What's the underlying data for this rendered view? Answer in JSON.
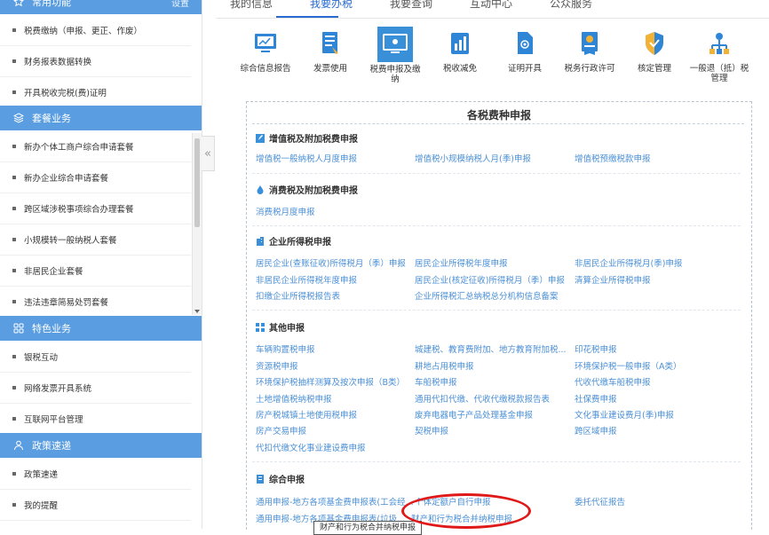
{
  "sidebar": {
    "sections": [
      {
        "title": "常用功能",
        "extra": "设置",
        "icon": "star-icon"
      },
      {
        "title": "套餐业务",
        "icon": "layers-icon"
      },
      {
        "title": "特色业务",
        "icon": "grid-icon"
      },
      {
        "title": "政策速递",
        "icon": "person-icon"
      }
    ],
    "common_items": [
      "税费缴纳（申报、更正、作废）",
      "财务报表数据转换",
      "开具税收完税(费)证明"
    ],
    "package_items": [
      "新办个体工商户综合申请套餐",
      "新办企业综合申请套餐",
      "跨区域涉税事项综合办理套餐",
      "小规模转一般纳税人套餐",
      "非居民企业套餐",
      "违法违章简易处罚套餐"
    ],
    "special_items": [
      "银税互动",
      "网络发票开具系统",
      "互联网平台管理"
    ],
    "policy_items": [
      "政策速递",
      "我的提醒"
    ]
  },
  "tabs": [
    "我的信息",
    "我要办税",
    "我要查询",
    "互动中心",
    "公众服务"
  ],
  "active_tab": "我要办税",
  "services": [
    {
      "label": "综合信息报告",
      "icon": "report-icon"
    },
    {
      "label": "发票使用",
      "icon": "invoice-icon"
    },
    {
      "label": "税费申报及缴纳",
      "icon": "monitor-icon"
    },
    {
      "label": "税收减免",
      "icon": "chart-icon"
    },
    {
      "label": "证明开具",
      "icon": "certificate-icon"
    },
    {
      "label": "税务行政许可",
      "icon": "badge-icon"
    },
    {
      "label": "核定管理",
      "icon": "shield-icon"
    },
    {
      "label": "一般退（抵）税管理",
      "icon": "network-icon"
    }
  ],
  "panel": {
    "title": "各税费种申报",
    "categories": [
      {
        "title": "增值税及附加税费申报",
        "icon": "edit-icon",
        "links": [
          "增值税一般纳税人月度申报",
          "增值税小规模纳税人月(季)申报",
          "增值税预缴税款申报"
        ]
      },
      {
        "title": "消费税及附加税费申报",
        "icon": "droplet-icon",
        "links": [
          "消费税月度申报"
        ]
      },
      {
        "title": "企业所得税申报",
        "icon": "building-icon",
        "links": [
          "居民企业(查账征收)所得税月（季）申报",
          "居民企业所得税年度申报",
          "非居民企业所得税月(季)申报",
          "非居民企业所得税年度申报",
          "居民企业(核定征收)所得税月（季）申报",
          "清算企业所得税申报",
          "扣缴企业所得税报告表",
          "企业所得税汇总纳税总分机构信息备案"
        ]
      },
      {
        "title": "其他申报",
        "icon": "grid-icon",
        "links": [
          "车辆购置税申报",
          "城建税、教育费附加、地方教育附加税...",
          "印花税申报",
          "资源税申报",
          "耕地占用税申报",
          "环境保护税一般申报（A类）",
          "环境保护税抽样测算及按次申报（B类）",
          "车船税申报",
          "代收代缴车船税申报",
          "土地增值税纳税申报",
          "通用代扣代缴、代收代缴税款报告表",
          "社保费申报",
          "房产税城镇土地使用税申报",
          "废弃电器电子产品处理基金申报",
          "文化事业建设费月(季)申报",
          "房产交易申报",
          "契税申报",
          "跨区域申报",
          "代扣代缴文化事业建设费申报"
        ]
      },
      {
        "title": "综合申报",
        "icon": "doc-icon",
        "links": [
          "通用申报-地方各项基金费申报表(工会经...",
          "个体定额户自行申报",
          "委托代征报告",
          "通用申报-地方各项基金费申报表(垃圾...",
          "财产和行为税合并纳税申报"
        ]
      }
    ],
    "tooltip": "财产和行为税合并纳税申报"
  },
  "colors": {
    "accent": "#2a6bd1",
    "section_head": "#5a9de0",
    "link": "#4a8fd6",
    "highlight": "#e01818"
  }
}
